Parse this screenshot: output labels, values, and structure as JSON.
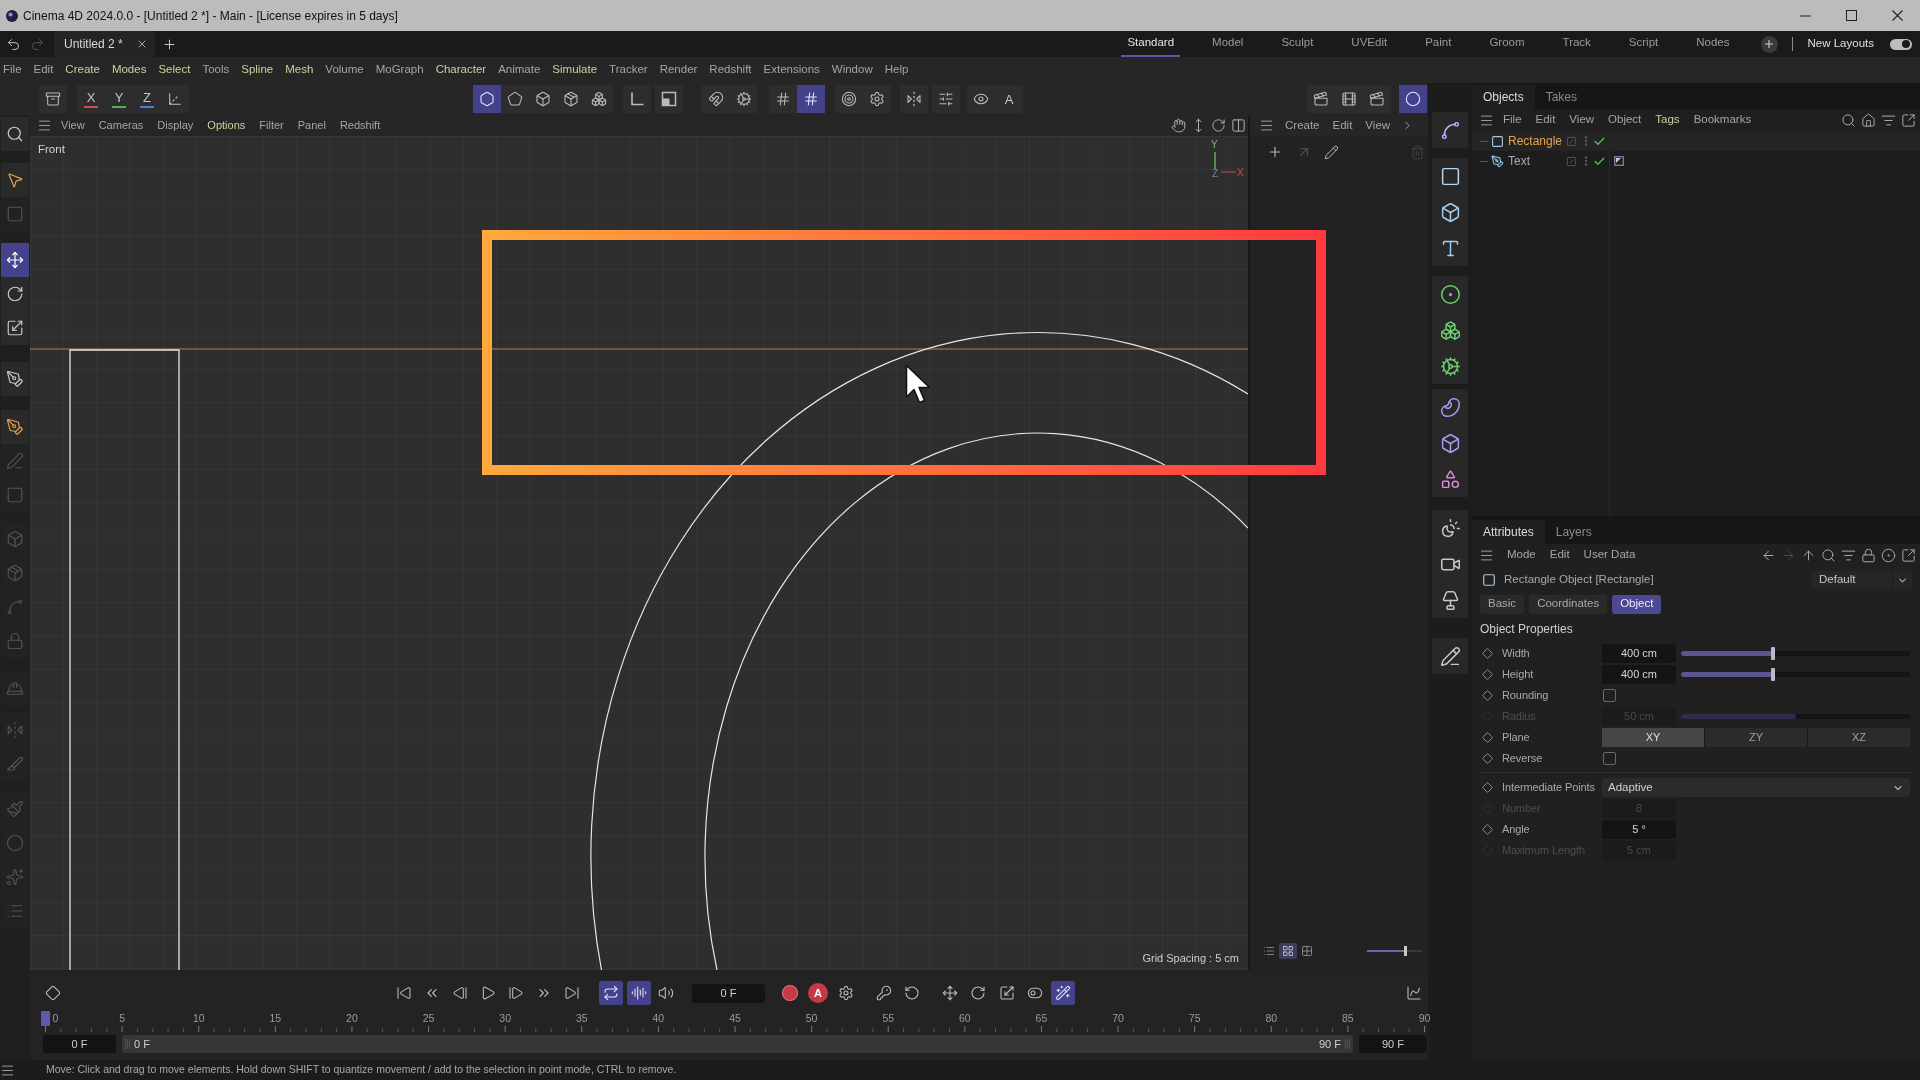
{
  "window": {
    "title": "Cinema 4D 2024.0.0 - [Untitled 2 *] - Main - [License expires in 5 days]"
  },
  "document_tabs": [
    {
      "label": "Untitled 2 *",
      "selected": true
    }
  ],
  "layouts": [
    {
      "label": "Standard",
      "selected": true
    },
    {
      "label": "Model",
      "selected": false
    },
    {
      "label": "Sculpt",
      "selected": false
    },
    {
      "label": "UVEdit",
      "selected": false
    },
    {
      "label": "Paint",
      "selected": false
    },
    {
      "label": "Groom",
      "selected": false
    },
    {
      "label": "Track",
      "selected": false
    },
    {
      "label": "Script",
      "selected": false
    },
    {
      "label": "Nodes",
      "selected": false
    }
  ],
  "new_layouts": {
    "label": "New Layouts",
    "on": true
  },
  "menu_bar": [
    {
      "label": "File",
      "highlighted": false
    },
    {
      "label": "Edit",
      "highlighted": false
    },
    {
      "label": "Create",
      "highlighted": true
    },
    {
      "label": "Modes",
      "highlighted": true
    },
    {
      "label": "Select",
      "highlighted": true
    },
    {
      "label": "Tools",
      "highlighted": false
    },
    {
      "label": "Spline",
      "highlighted": true
    },
    {
      "label": "Mesh",
      "highlighted": true
    },
    {
      "label": "Volume",
      "highlighted": false
    },
    {
      "label": "MoGraph",
      "highlighted": false
    },
    {
      "label": "Character",
      "highlighted": true
    },
    {
      "label": "Animate",
      "highlighted": false
    },
    {
      "label": "Simulate",
      "highlighted": true
    },
    {
      "label": "Tracker",
      "highlighted": false
    },
    {
      "label": "Render",
      "highlighted": false
    },
    {
      "label": "Redshift",
      "highlighted": false
    },
    {
      "label": "Extensions",
      "highlighted": false
    },
    {
      "label": "Window",
      "highlighted": false
    },
    {
      "label": "Help",
      "highlighted": false
    }
  ],
  "main_toolbar": [
    {
      "selected": false
    },
    {
      "label": "X",
      "color": "#d24a4a",
      "selected": false
    },
    {
      "label": "Y",
      "color": "#55b055",
      "selected": false
    },
    {
      "label": "Z",
      "color": "#4a80d6",
      "selected": false
    },
    {
      "selected": false
    },
    {
      "selected": true
    },
    {
      "selected": false
    },
    {
      "selected": false
    },
    {
      "selected": false
    },
    {
      "selected": false
    },
    {
      "selected": false
    },
    {
      "selected": false
    },
    {
      "selected": false
    },
    {
      "selected": false
    },
    {
      "selected": false
    },
    {
      "selected": true
    },
    {
      "selected": false
    },
    {
      "selected": false
    },
    {
      "selected": false
    },
    {
      "selected": false
    },
    {
      "selected": false
    },
    {
      "label": "A",
      "selected": false
    },
    {
      "selected": false
    },
    {
      "selected": false
    },
    {
      "selected": false
    },
    {
      "selected": true
    }
  ],
  "left_tools": [
    {
      "selected": false,
      "disabled": false
    },
    {
      "selected": false,
      "disabled": false
    },
    {
      "selected": false,
      "disabled": true
    },
    {
      "selected": true,
      "disabled": false
    },
    {
      "selected": false,
      "disabled": false
    },
    {
      "selected": false,
      "disabled": false
    },
    {
      "selected": false,
      "disabled": false
    },
    {
      "selected": false,
      "disabled": false
    },
    {
      "selected": false,
      "disabled": true
    },
    {
      "selected": false,
      "disabled": true
    },
    {
      "selected": false,
      "disabled": true
    },
    {
      "selected": false,
      "disabled": true
    },
    {
      "selected": false,
      "disabled": true
    },
    {
      "selected": false,
      "disabled": true
    },
    {
      "selected": false,
      "disabled": true
    },
    {
      "selected": false,
      "disabled": true
    },
    {
      "selected": false,
      "disabled": true
    },
    {
      "selected": false,
      "disabled": true
    },
    {
      "selected": false,
      "disabled": true
    },
    {
      "selected": false,
      "disabled": true
    },
    {
      "selected": false,
      "disabled": true
    }
  ],
  "viewport": {
    "menu": [
      {
        "label": "View",
        "highlighted": false
      },
      {
        "label": "Cameras",
        "highlighted": false
      },
      {
        "label": "Display",
        "highlighted": false
      },
      {
        "label": "Options",
        "highlighted": true
      },
      {
        "label": "Filter",
        "highlighted": false
      },
      {
        "label": "Panel",
        "highlighted": false
      },
      {
        "label": "Redshift",
        "highlighted": false
      }
    ],
    "camera": "Front",
    "gizmo_labels": [
      "Y",
      "Z",
      "X"
    ],
    "grid_spacing": "Grid Spacing : 5 cm"
  },
  "asset_panel": {
    "menu": [
      "Create",
      "Edit",
      "View"
    ],
    "view_modes": [
      {
        "selected": false
      },
      {
        "selected": true
      },
      {
        "selected": false
      }
    ],
    "thumbnail_size": {
      "level": 0.69
    }
  },
  "objects_panel": {
    "tabs": [
      {
        "label": "Objects",
        "selected": true
      },
      {
        "label": "Takes",
        "selected": false
      }
    ],
    "menu": [
      {
        "label": "File",
        "highlighted": false
      },
      {
        "label": "Edit",
        "highlighted": false
      },
      {
        "label": "View",
        "highlighted": false
      },
      {
        "label": "Object",
        "highlighted": false
      },
      {
        "label": "Tags",
        "highlighted": true
      },
      {
        "label": "Bookmarks",
        "highlighted": false
      }
    ],
    "objects": [
      {
        "name": "Rectangle",
        "kind": "rectangle",
        "selected": true,
        "enabled": true,
        "tagged": false
      },
      {
        "name": "Text",
        "kind": "text",
        "selected": false,
        "enabled": true,
        "tagged": true
      }
    ]
  },
  "attributes_panel": {
    "tabs": [
      {
        "label": "Attributes",
        "selected": true
      },
      {
        "label": "Layers",
        "selected": false
      }
    ],
    "menu": [
      "Mode",
      "Edit",
      "User Data"
    ],
    "object_title": "Rectangle Object [Rectangle]",
    "preset": "Default",
    "sections": [
      {
        "label": "Basic",
        "selected": false
      },
      {
        "label": "Coordinates",
        "selected": false
      },
      {
        "label": "Object",
        "selected": true
      }
    ],
    "group_title": "Object Properties",
    "property_groups": [
      [
        {
          "kind": "slider",
          "label": "Width",
          "value": "400 cm",
          "level": 0.4,
          "disabled": false
        },
        {
          "kind": "slider",
          "label": "Height",
          "value": "400 cm",
          "level": 0.4,
          "disabled": false
        },
        {
          "kind": "checkbox",
          "label": "Rounding",
          "checked": false,
          "disabled": false
        },
        {
          "kind": "slider",
          "label": "Radius",
          "value": "50 cm",
          "level": 0.5,
          "disabled": true
        },
        {
          "kind": "segmented",
          "label": "Plane",
          "options": [
            {
              "label": "XY",
              "selected": true
            },
            {
              "label": "ZY",
              "selected": false
            },
            {
              "label": "XZ",
              "selected": false
            }
          ],
          "disabled": false
        },
        {
          "kind": "checkbox",
          "label": "Reverse",
          "checked": false,
          "disabled": false
        }
      ],
      [
        {
          "kind": "dropdown",
          "label": "Intermediate Points",
          "value": "Adaptive",
          "disabled": false
        },
        {
          "kind": "number",
          "label": "Number",
          "value": "8",
          "disabled": true
        },
        {
          "kind": "number",
          "label": "Angle",
          "value": "5 °",
          "disabled": false
        },
        {
          "kind": "number",
          "label": "Maximum Length",
          "value": "5 cm",
          "disabled": true
        }
      ]
    ]
  },
  "timeline": {
    "playback": [
      {
        "selected": false
      },
      {
        "selected": false
      },
      {
        "selected": false
      },
      {
        "selected": false
      },
      {
        "selected": false
      },
      {
        "selected": false
      },
      {
        "selected": false
      },
      {
        "selected": false
      },
      {
        "selected": true
      },
      {
        "selected": true
      },
      {
        "selected": false
      }
    ],
    "current_frame": "0 F",
    "record": [
      {
        "selected": false
      },
      {
        "label": "A",
        "selected": false
      },
      {
        "selected": false
      },
      {
        "selected": false
      },
      {
        "selected": false
      },
      {
        "selected": false
      },
      {
        "selected": false
      },
      {
        "selected": false
      },
      {
        "selected": false
      },
      {
        "selected": true
      },
      {
        "selected": false
      }
    ],
    "ruler": [
      "0",
      "5",
      "10",
      "15",
      "20",
      "25",
      "30",
      "35",
      "40",
      "45",
      "50",
      "55",
      "60",
      "65",
      "70",
      "75",
      "80",
      "85",
      "90"
    ],
    "playhead": {
      "level": 0
    },
    "range": {
      "start_field": "0 F",
      "bar_start": "0 F",
      "bar_end": "90 F",
      "end_field": "90 F"
    }
  },
  "status_bar": {
    "message": "Move: Click and drag to move elements. Hold down SHIFT to quantize movement / add to the selection in point mode, CTRL to remove."
  }
}
